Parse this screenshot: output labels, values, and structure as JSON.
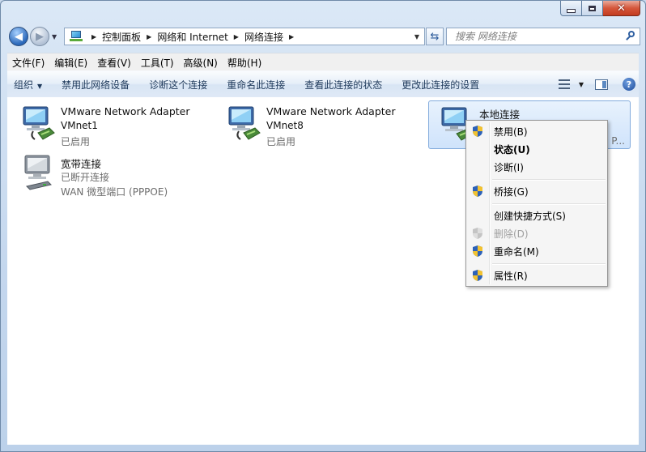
{
  "window": {
    "minimize_icon": "minimize-icon",
    "maximize_icon": "maximize-icon",
    "close_icon": "close-icon",
    "close_glyph": "✕"
  },
  "address": {
    "crumbs": [
      "控制面板",
      "网络和 Internet",
      "网络连接"
    ],
    "search_placeholder": "搜索 网络连接"
  },
  "menu": [
    "文件(F)",
    "编辑(E)",
    "查看(V)",
    "工具(T)",
    "高级(N)",
    "帮助(H)"
  ],
  "toolbar": {
    "organize": "组织",
    "disable": "禁用此网络设备",
    "diagnose": "诊断这个连接",
    "rename": "重命名此连接",
    "view_status": "查看此连接的状态",
    "change_settings": "更改此连接的设置",
    "help": "?"
  },
  "connections": [
    {
      "name": "VMware Network Adapter",
      "sub": "VMnet1",
      "status": "已启用"
    },
    {
      "name": "VMware Network Adapter",
      "sub": "VMnet8",
      "status": "已启用"
    },
    {
      "name": "本地连接",
      "truncated": "P..."
    },
    {
      "name": "宽带连接",
      "status": "已断开连接",
      "device": "WAN 微型端口 (PPPOE)"
    }
  ],
  "context_menu": [
    {
      "label": "禁用(B)",
      "shield": true
    },
    {
      "label": "状态(U)",
      "bold": true
    },
    {
      "label": "诊断(I)"
    },
    {
      "label": "桥接(G)",
      "shield": true
    },
    {
      "label": "创建快捷方式(S)"
    },
    {
      "label": "删除(D)",
      "shield": true,
      "disabled": true
    },
    {
      "label": "重命名(M)",
      "shield": true
    },
    {
      "label": "属性(R)",
      "shield": true
    }
  ],
  "colors": {
    "accent": "#1e395b",
    "selection": "#cfe3fb",
    "close": "#c23b1f"
  }
}
